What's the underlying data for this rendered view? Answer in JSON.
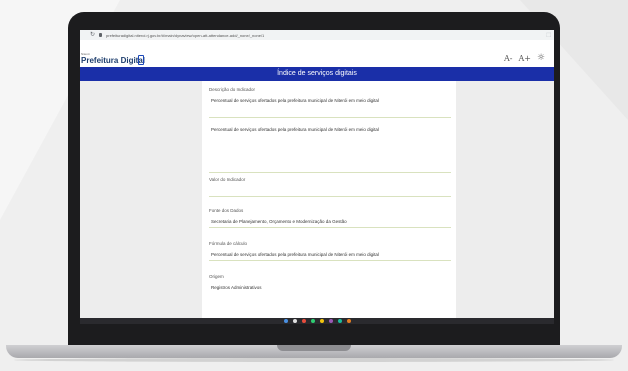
{
  "browser": {
    "url": "prefeituradigital.niteroi.rj.gov.br/#/main/dynaview/open-att-attendance-add/_none/_none/1"
  },
  "app": {
    "brand_small": "Niterói",
    "brand": "Prefeitura Digital",
    "font_decrease": "A-",
    "font_increase": "A+"
  },
  "page_title": "Índice de serviços digitais",
  "form": {
    "descricao_label": "Descrição do Indicador",
    "descricao_value": "Percentual de serviços ofertados pela prefeitura municipal de Niterói em meio digital",
    "descricao_text": "Percentual de serviços ofertados pela prefeitura municipal de Niterói em meio digital",
    "valor_label": "Valor do Indicador",
    "valor_value": "",
    "fonte_label": "Fonte dos Dados",
    "fonte_value": "Secretaria de Planejamento, Orçamento e Modernização da Gestão",
    "formula_label": "Fórmula de cálculo",
    "formula_value": "Percentual de serviços ofertados pela prefeitura municipal de Niterói em meio digital",
    "origem_label": "Origem",
    "origem_value": "Registros Administrativos"
  },
  "colors": {
    "title_bar": "#1a2fa8",
    "field_underline": "#d9e2bf",
    "laptop_bezel": "#1c1c1e"
  }
}
